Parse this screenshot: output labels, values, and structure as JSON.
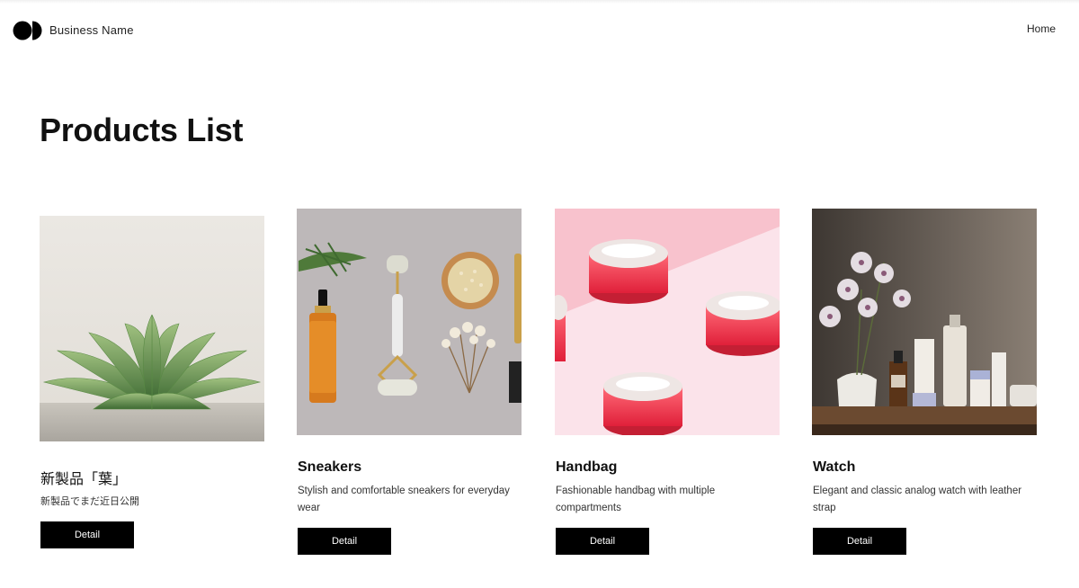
{
  "header": {
    "brand_name": "Business Name",
    "logo_icon": "two-circle-logo-icon",
    "nav": [
      {
        "label": "Home"
      }
    ]
  },
  "page": {
    "title": "Products List"
  },
  "products": [
    {
      "title": "新製品「葉」",
      "description": "新製品でまだ近日公開",
      "button_label": "Detail",
      "image": "succulent-plant-photo"
    },
    {
      "title": "Sneakers",
      "description": "Stylish and comfortable sneakers for everyday wear",
      "button_label": "Detail",
      "image": "skincare-flatlay-photo"
    },
    {
      "title": "Handbag",
      "description": "Fashionable handbag with multiple compartments",
      "button_label": "Detail",
      "image": "pink-cream-jars-photo"
    },
    {
      "title": "Watch",
      "description": "Elegant and classic analog watch with leather strap",
      "button_label": "Detail",
      "image": "orchid-shelf-photo"
    }
  ],
  "colors": {
    "button_bg": "#000000",
    "button_text": "#ffffff",
    "text": "#111111",
    "background": "#ffffff"
  }
}
